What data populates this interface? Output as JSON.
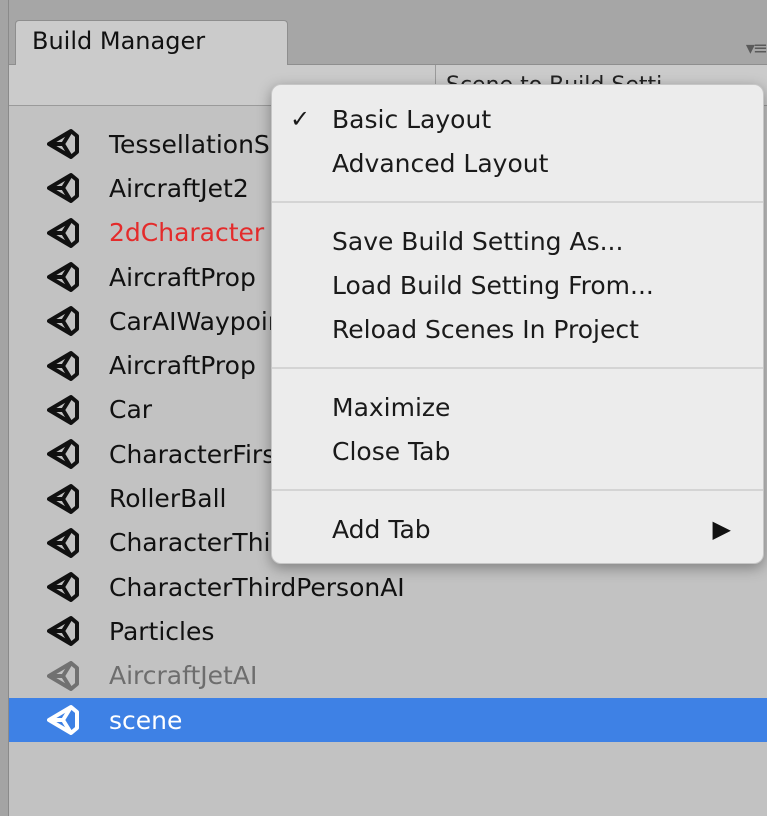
{
  "window": {
    "tab_title": "Build Manager",
    "toolbar_button": "Scene to Build Setti..."
  },
  "scene_list": [
    {
      "name": "TessellationS",
      "style": "normal"
    },
    {
      "name": "AircraftJet2",
      "style": "normal"
    },
    {
      "name": "2dCharacter",
      "style": "red"
    },
    {
      "name": "AircraftProp",
      "style": "normal"
    },
    {
      "name": "CarAIWaypoint",
      "style": "normal"
    },
    {
      "name": "AircraftProp",
      "style": "normal"
    },
    {
      "name": "Car",
      "style": "normal"
    },
    {
      "name": "CharacterFirst",
      "style": "normal"
    },
    {
      "name": "RollerBall",
      "style": "normal"
    },
    {
      "name": "CharacterThird",
      "style": "normal"
    },
    {
      "name": "CharacterThirdPersonAI",
      "style": "normal"
    },
    {
      "name": "Particles",
      "style": "normal"
    },
    {
      "name": "AircraftJetAI",
      "style": "disabled"
    },
    {
      "name": "scene",
      "style": "selected"
    }
  ],
  "context_menu": {
    "check_glyph": "✓",
    "submenu_glyph": "▶",
    "items": {
      "basic_layout": "Basic Layout",
      "advanced_layout": "Advanced Layout",
      "save_build_setting": "Save Build Setting As...",
      "load_build_setting": "Load Build Setting From...",
      "reload_scenes": "Reload Scenes In Project",
      "maximize": "Maximize",
      "close_tab": "Close Tab",
      "add_tab": "Add Tab"
    }
  },
  "colors": {
    "selected_row": "#3e81e5",
    "red_text": "#e42b2b",
    "panel_bg": "#c2c2c2"
  }
}
